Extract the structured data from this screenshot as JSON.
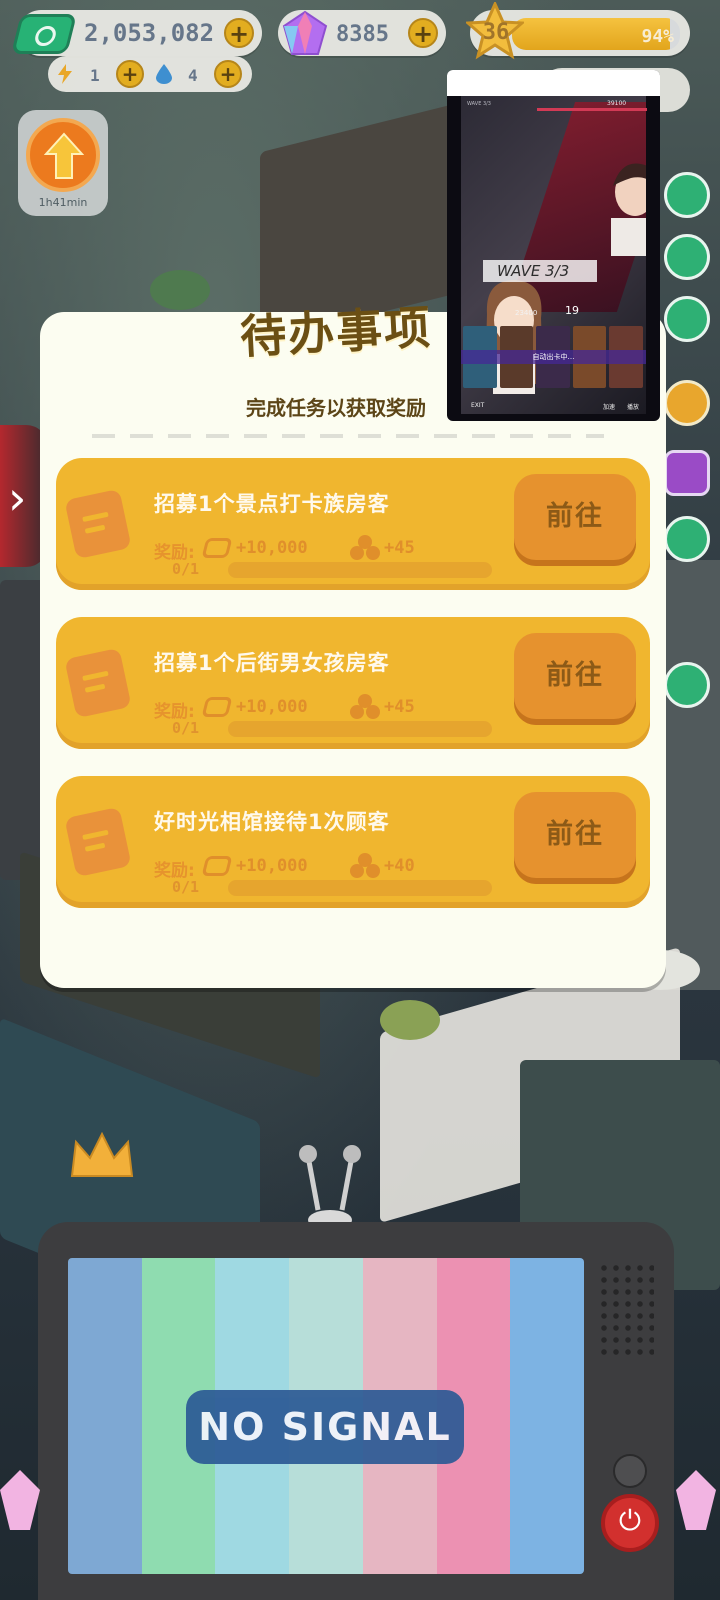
{
  "hud": {
    "cash": "2,053,082",
    "gems": "8385",
    "level": "36",
    "level_progress_label": "94%",
    "level_progress": 0.94,
    "energy": "1",
    "water": "4",
    "boost_timer": "1h41min"
  },
  "panel": {
    "title": "待办事项",
    "subtitle": "完成任务以获取奖励",
    "reward_label": "奖励:",
    "go_label": "前往",
    "tasks": [
      {
        "name": "招募1个景点打卡族房客",
        "cash_reward": "+10,000",
        "xp_reward": "+45",
        "progress": "0/1",
        "progress_value": 0
      },
      {
        "name": "招募1个后街男女孩房客",
        "cash_reward": "+10,000",
        "xp_reward": "+45",
        "progress": "0/1",
        "progress_value": 0
      },
      {
        "name": "好时光相馆接待1次顾客",
        "cash_reward": "+10,000",
        "xp_reward": "+40",
        "progress": "0/1",
        "progress_value": 0
      }
    ]
  },
  "video": {
    "wave_header": "WAVE 3/3",
    "score_header": "39100",
    "wave_banner": "WAVE 3/3",
    "score_bottom": "23400",
    "round": "19",
    "auto_text": "自动出卡中…",
    "exit_label": "EXIT",
    "speed_label": "加速",
    "play_label": "播放"
  },
  "tv": {
    "no_signal": "NO SIGNAL",
    "bar_colors": [
      "#7ea8d3",
      "#8fdcb0",
      "#9fd9e2",
      "#b7ded9",
      "#e6b6c2",
      "#ec91b2",
      "#7db3e3"
    ]
  },
  "left_tab": {
    "arrow": "›"
  }
}
